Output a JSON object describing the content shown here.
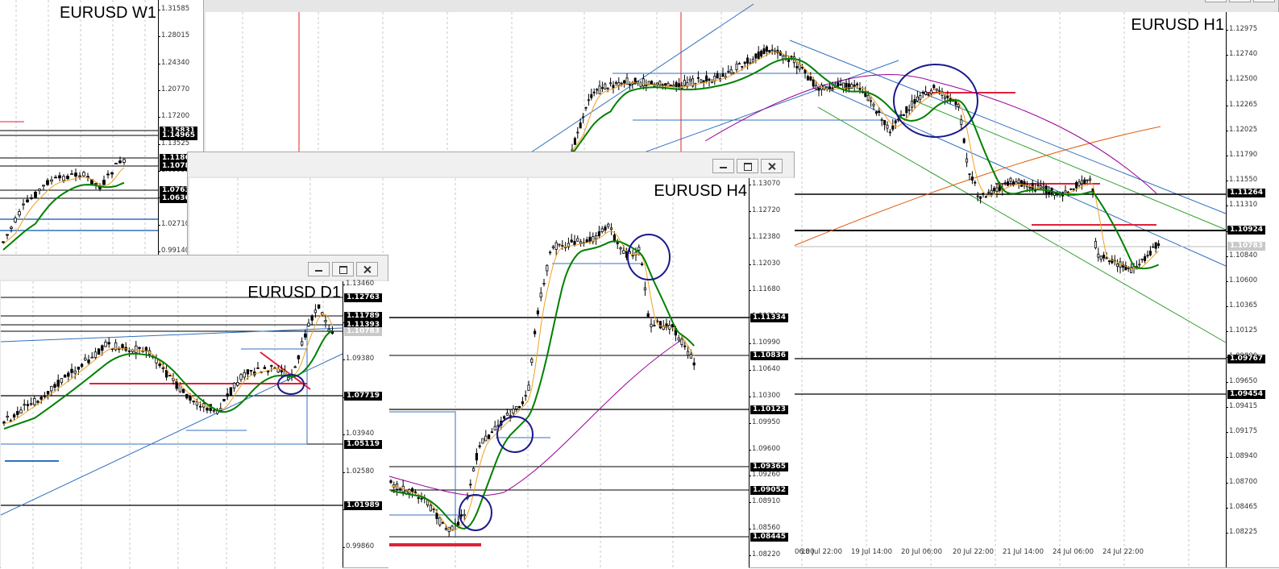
{
  "windows": {
    "w1": {
      "title": "EURUSD W1",
      "ticks": [
        "1.31585",
        "1.28015",
        "1.24340",
        "1.20770",
        "1.17200",
        "1.13525",
        "1.09955",
        "1.06380",
        "1.02710",
        "0.99140"
      ],
      "labels": [
        {
          "text": "1.15831",
          "v": 1.15831,
          "grey": false
        },
        {
          "text": "1.14965",
          "v": 1.14965,
          "grey": false
        },
        {
          "text": "1.11865",
          "v": 1.11865,
          "grey": false
        },
        {
          "text": "1.10783",
          "v": 1.10783,
          "grey": false
        },
        {
          "text": "1.07632",
          "v": 1.07632,
          "grey": false
        },
        {
          "text": "1.06365",
          "v": 1.06365,
          "grey": false
        }
      ]
    },
    "h1": {
      "title": "EURUSD H1",
      "ticks": [
        "1.12975",
        "1.12740",
        "1.12500",
        "1.12265",
        "1.12025",
        "1.11790",
        "1.11550",
        "1.11310",
        "1.11075",
        "1.10840",
        "1.10600",
        "1.10365",
        "1.10125",
        "1.09890",
        "1.09650",
        "1.09415",
        "1.09175",
        "1.08940",
        "1.08700",
        "1.08465",
        "1.08225"
      ],
      "labels": [
        {
          "text": "1.11264",
          "v": 1.11264,
          "grey": false
        },
        {
          "text": "1.10924",
          "v": 1.10924,
          "grey": false
        },
        {
          "text": "1.10783",
          "v": 1.10783,
          "grey": true
        },
        {
          "text": "1.09767",
          "v": 1.09767,
          "grey": false
        },
        {
          "text": "1.09454",
          "v": 1.09454,
          "grey": false
        }
      ],
      "time_labels": [
        "18 Jul 22:00",
        "19 Jul 14:00",
        "20 Jul 06:00",
        "20 Jul 22:00",
        "21 Jul 14:00",
        "24 Jul 06:00",
        "24 Jul 22:00"
      ],
      "time_label_first": "06:00"
    },
    "h4": {
      "title": "EURUSD H4",
      "ticks": [
        "1.13070",
        "1.12720",
        "1.12380",
        "1.12030",
        "1.11680",
        "1.11340",
        "1.10990",
        "1.10640",
        "1.10300",
        "1.09950",
        "1.09600",
        "1.09260",
        "1.08910",
        "1.08560",
        "1.08220"
      ],
      "labels": [
        {
          "text": "1.11334",
          "v": 1.11334,
          "grey": false
        },
        {
          "text": "1.10836",
          "v": 1.10836,
          "grey": false
        },
        {
          "text": "1.10123",
          "v": 1.10123,
          "grey": false
        },
        {
          "text": "1.09365",
          "v": 1.09365,
          "grey": false
        },
        {
          "text": "1.09052",
          "v": 1.09052,
          "grey": false
        },
        {
          "text": "1.08445",
          "v": 1.08445,
          "grey": false
        }
      ]
    },
    "d1": {
      "title": "EURUSD D1",
      "ticks": [
        "1.13460",
        "1.10400",
        "1.09380",
        "1.06660",
        "1.03940",
        "1.02580",
        "1.01220",
        "0.99860"
      ],
      "labels": [
        {
          "text": "1.12763",
          "v": 1.12763,
          "grey": false
        },
        {
          "text": "1.11789",
          "v": 1.11789,
          "grey": false
        },
        {
          "text": "1.11393",
          "v": 1.11393,
          "grey": false
        },
        {
          "text": "1.10783",
          "v": 1.10783,
          "grey": true
        },
        {
          "text": "1.07719",
          "v": 1.07719,
          "grey": false
        },
        {
          "text": "1.05119",
          "v": 1.05119,
          "grey": false
        },
        {
          "text": "1.01989",
          "v": 1.01989,
          "grey": false
        }
      ]
    }
  },
  "colors": {
    "candle": "#000000",
    "ma_fast": "#f0a020",
    "ma_green": "#008000",
    "ma_purple": "#990099",
    "ma_orange": "#e06010",
    "channel_blue": "#3070c0",
    "channel_green": "#30a030",
    "level_red": "#e0203a",
    "circle": "#1a1a8c",
    "vline_red": "#e02020"
  }
}
